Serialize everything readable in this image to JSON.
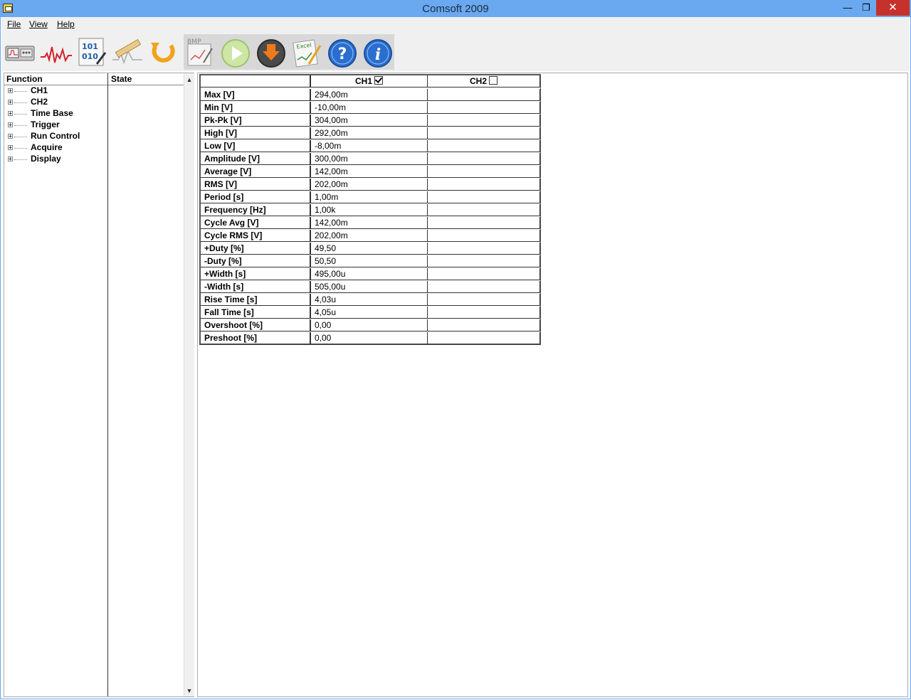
{
  "window": {
    "title": "Comsoft 2009",
    "minimize_glyph": "—",
    "restore_glyph": "❐",
    "close_glyph": "✕"
  },
  "menu": {
    "file": "File",
    "view": "View",
    "help": "Help"
  },
  "toolbar": {
    "buttons": [
      {
        "icon": "oscilloscope-icon"
      },
      {
        "icon": "waveform-icon"
      },
      {
        "icon": "binary-data-icon"
      },
      {
        "icon": "measure-ruler-icon"
      },
      {
        "icon": "refresh-icon"
      },
      {
        "icon": "bmp-export-icon",
        "text": "BMP"
      },
      {
        "icon": "run-play-icon"
      },
      {
        "icon": "download-icon"
      },
      {
        "icon": "excel-export-icon",
        "text": "Excel"
      },
      {
        "icon": "help-icon",
        "text": "?"
      },
      {
        "icon": "info-icon",
        "text": "i"
      }
    ]
  },
  "tree": {
    "col_function": "Function",
    "col_state": "State",
    "items": [
      {
        "label": "CH1"
      },
      {
        "label": "CH2"
      },
      {
        "label": "Time Base"
      },
      {
        "label": "Trigger"
      },
      {
        "label": "Run Control"
      },
      {
        "label": "Acquire"
      },
      {
        "label": "Display"
      }
    ]
  },
  "measurements": {
    "header": {
      "ch1": "CH1",
      "ch1_checked": true,
      "ch2": "CH2",
      "ch2_checked": false
    },
    "rows": [
      {
        "label": "Max [V]",
        "ch1": "294,00m",
        "ch2": ""
      },
      {
        "label": "Min [V]",
        "ch1": "-10,00m",
        "ch2": ""
      },
      {
        "label": "Pk-Pk [V]",
        "ch1": "304,00m",
        "ch2": ""
      },
      {
        "label": "High [V]",
        "ch1": "292,00m",
        "ch2": ""
      },
      {
        "label": "Low [V]",
        "ch1": "-8,00m",
        "ch2": ""
      },
      {
        "label": "Amplitude [V]",
        "ch1": "300,00m",
        "ch2": ""
      },
      {
        "label": "Average [V]",
        "ch1": "142,00m",
        "ch2": ""
      },
      {
        "label": "RMS [V]",
        "ch1": "202,00m",
        "ch2": ""
      },
      {
        "label": "Period [s]",
        "ch1": "1,00m",
        "ch2": ""
      },
      {
        "label": "Frequency [Hz]",
        "ch1": "1,00k",
        "ch2": ""
      },
      {
        "label": "Cycle Avg [V]",
        "ch1": "142,00m",
        "ch2": ""
      },
      {
        "label": "Cycle RMS [V]",
        "ch1": "202,00m",
        "ch2": ""
      },
      {
        "label": "+Duty [%]",
        "ch1": "49,50",
        "ch2": ""
      },
      {
        "label": "-Duty [%]",
        "ch1": "50,50",
        "ch2": ""
      },
      {
        "label": "+Width [s]",
        "ch1": "495,00u",
        "ch2": ""
      },
      {
        "label": "-Width [s]",
        "ch1": "505,00u",
        "ch2": ""
      },
      {
        "label": "Rise Time [s]",
        "ch1": "4,03u",
        "ch2": ""
      },
      {
        "label": "Fall Time [s]",
        "ch1": "4,05u",
        "ch2": ""
      },
      {
        "label": "Overshoot [%]",
        "ch1": " 0,00",
        "ch2": ""
      },
      {
        "label": "Preshoot [%]",
        "ch1": " 0,00",
        "ch2": ""
      }
    ]
  }
}
